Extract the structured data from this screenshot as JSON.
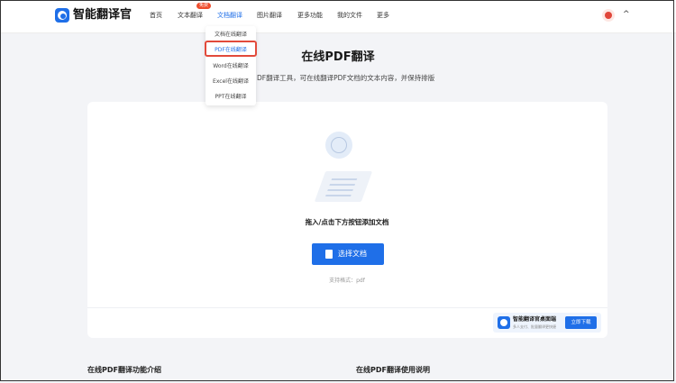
{
  "header": {
    "logo_text": "智能翻译官",
    "logo_icon": "app-logo-icon",
    "nav": [
      {
        "label": "首页"
      },
      {
        "label": "文本翻译",
        "badge": "免费"
      },
      {
        "label": "文档翻译",
        "active": true
      },
      {
        "label": "图片翻译"
      },
      {
        "label": "更多功能"
      },
      {
        "label": "我的文件"
      },
      {
        "label": "更多"
      }
    ],
    "avatar_icon": "avatar-icon",
    "chevron": "^"
  },
  "dropdown": {
    "items": [
      {
        "label": "文档在线翻译"
      },
      {
        "label": "PDF在线翻译",
        "highlighted": true
      },
      {
        "label": "Word在线翻译"
      },
      {
        "label": "Excel在线翻译"
      },
      {
        "label": "PPT在线翻译"
      }
    ]
  },
  "main": {
    "title": "在线PDF翻译",
    "subtitle": "DF翻译工具，可在线翻译PDF文档的文本内容，并保持排版",
    "drop_label": "拖入/点击下方按钮添加文档",
    "select_button": "选择文档",
    "formats": "支持格式：pdf"
  },
  "app_card": {
    "title": "智能翻译官桌面端",
    "desc": "多人支付、批量翻译更快捷",
    "download_button": "立即下载"
  },
  "sections": {
    "left": "在线PDF翻译功能介绍",
    "right": "在线PDF翻译使用说明"
  },
  "colors": {
    "accent": "#1f6fe8",
    "highlight_border": "#e24a3b",
    "badge": "#ee4d2d"
  }
}
